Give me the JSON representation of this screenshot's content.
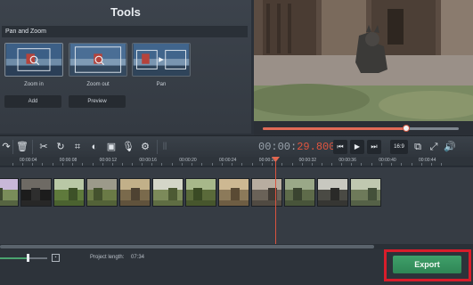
{
  "tools": {
    "title": "Tools",
    "section_title": "Pan and Zoom",
    "presets": [
      {
        "label": "Zoom in"
      },
      {
        "label": "Zoom out"
      },
      {
        "label": "Pan"
      }
    ],
    "add_button": "Add",
    "preview_button": "Preview"
  },
  "player": {
    "timecode_dim": "00:00:",
    "timecode_active": "29.800",
    "seek_progress": 0.73,
    "aspect_ratio": "16:9"
  },
  "timeline": {
    "ticks": [
      "00:00:04",
      "00:00:08",
      "00:00:12",
      "00:00:16",
      "00:00:20",
      "00:00:24",
      "00:00:28",
      "00:00:32",
      "00:00:36",
      "00:00:40",
      "00:00:44"
    ],
    "clip_count": 12
  },
  "bottom": {
    "project_length_label": "Project length:",
    "project_length_value": "07:34",
    "export_label": "Export"
  },
  "colors": {
    "accent_red": "#e2553f",
    "export_green": "#3fa06a",
    "highlight_frame": "#d81d2b"
  }
}
